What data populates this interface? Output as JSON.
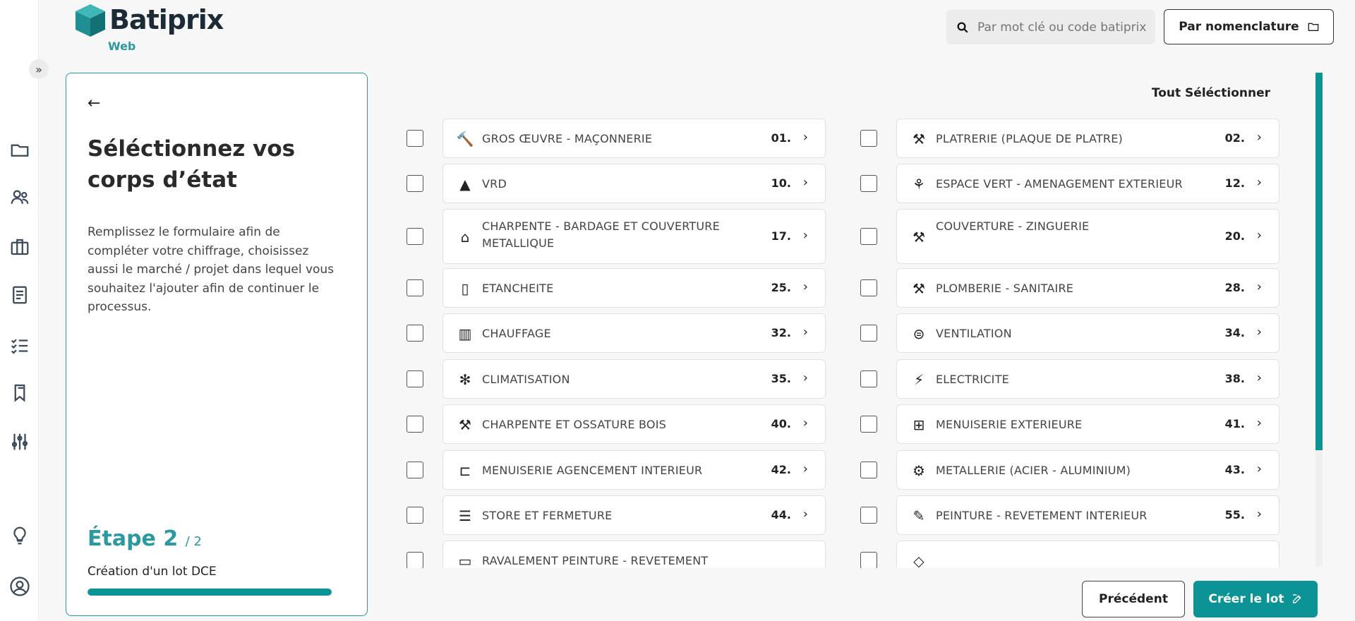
{
  "header": {
    "brand": "Batiprix",
    "brand_sub": "Web",
    "search_placeholder": "Par mot clé ou code batiprix",
    "nomenclature_label": "Par nomenclature"
  },
  "panel": {
    "title": "Séléctionnez vos corps d’état",
    "description": "Remplissez le formulaire afin de compléter votre chiffrage, choisissez aussi le marché / projet dans lequel vous souhaitez l'ajouter afin de continuer le processus.",
    "step_label": "Étape 2",
    "step_total": "/ 2",
    "step_name": "Création d'un lot DCE",
    "progress": 1.0
  },
  "select_all_label": "Tout Séléctionner",
  "trades": [
    {
      "label": "GROS ŒUVRE - MAÇONNERIE",
      "code": "01.",
      "icon": "🔨"
    },
    {
      "label": "PLATRERIE (PLAQUE DE PLATRE)",
      "code": "02.",
      "icon": "⚒"
    },
    {
      "label": "VRD",
      "code": "10.",
      "icon": "▲"
    },
    {
      "label": "ESPACE VERT - AMENAGEMENT EXTERIEUR",
      "code": "12.",
      "icon": "⚘"
    },
    {
      "label": "CHARPENTE - BARDAGE ET COUVERTURE METALLIQUE",
      "code": "17.",
      "icon": "⌂"
    },
    {
      "label": "COUVERTURE - ZINGUERIE",
      "code": "20.",
      "icon": "⚒"
    },
    {
      "label": "ETANCHEITE",
      "code": "25.",
      "icon": "▯"
    },
    {
      "label": "PLOMBERIE - SANITAIRE",
      "code": "28.",
      "icon": "⚒"
    },
    {
      "label": "CHAUFFAGE",
      "code": "32.",
      "icon": "▥"
    },
    {
      "label": "VENTILATION",
      "code": "34.",
      "icon": "⊜"
    },
    {
      "label": "CLIMATISATION",
      "code": "35.",
      "icon": "✻"
    },
    {
      "label": "ELECTRICITE",
      "code": "38.",
      "icon": "⚡"
    },
    {
      "label": "CHARPENTE ET OSSATURE BOIS",
      "code": "40.",
      "icon": "⚒"
    },
    {
      "label": "MENUISERIE EXTERIEURE",
      "code": "41.",
      "icon": "⊞"
    },
    {
      "label": "MENUISERIE AGENCEMENT INTERIEUR",
      "code": "42.",
      "icon": "⊏"
    },
    {
      "label": "METALLERIE (ACIER - ALUMINIUM)",
      "code": "43.",
      "icon": "⚙"
    },
    {
      "label": "STORE ET FERMETURE",
      "code": "44.",
      "icon": "☰"
    },
    {
      "label": "PEINTURE - REVETEMENT INTERIEUR",
      "code": "55.",
      "icon": "✎"
    },
    {
      "label": "RAVALEMENT PEINTURE - REVETEMENT",
      "code": "",
      "icon": "▭"
    },
    {
      "label": "",
      "code": "",
      "icon": "◇"
    }
  ],
  "footer": {
    "prev_label": "Précédent",
    "create_label": "Créer le lot"
  }
}
